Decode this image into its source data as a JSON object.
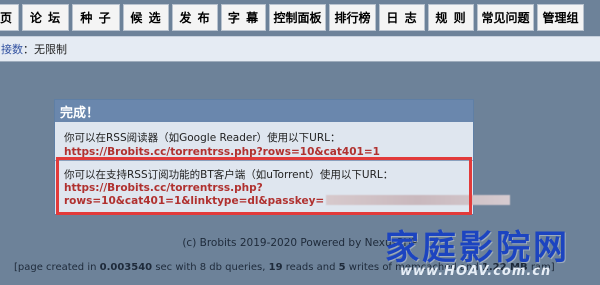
{
  "nav": {
    "items": [
      {
        "label": "页"
      },
      {
        "label": "论 坛"
      },
      {
        "label": "种 子"
      },
      {
        "label": "候 选"
      },
      {
        "label": "发 布"
      },
      {
        "label": "字 幕"
      },
      {
        "label": "控制面板"
      },
      {
        "label": "排行榜"
      },
      {
        "label": "日 志"
      },
      {
        "label": "规 则"
      },
      {
        "label": "常见问题"
      },
      {
        "label": "管理组"
      }
    ]
  },
  "info_strip": {
    "label": "接数",
    "value": "：无限制"
  },
  "dialog": {
    "title": "完成！",
    "row1_label": "你可以在RSS阅读器（如Google Reader）使用以下URL：",
    "row1_url": "https://Brobits.cc/torrentrss.php?rows=10&cat401=1",
    "row2_label": "你可以在支持RSS订阅功能的BT客户端（如uTorrent）使用以下URL：",
    "row2_url_line1": "https://Brobits.cc/torrentrss.php?",
    "row2_url_line2": "rows=10&cat401=1&linktype=dl&passkey="
  },
  "footer": {
    "powered": "(c) Brobits 2019-2020 Powered by NexusPHP",
    "stats_prefix": "[page created in ",
    "stats_time": "0.003540",
    "stats_mid1": " sec with 8 db queries, ",
    "stats_reads": "19",
    "stats_mid2": " reads and ",
    "stats_writes": "5",
    "stats_mid3": " writes of memcached and ",
    "stats_ram": "1.22 MB",
    "stats_suffix": " ram]"
  },
  "watermark": {
    "title": "家庭影院网",
    "url": "www.HOAV.com.cn"
  }
}
